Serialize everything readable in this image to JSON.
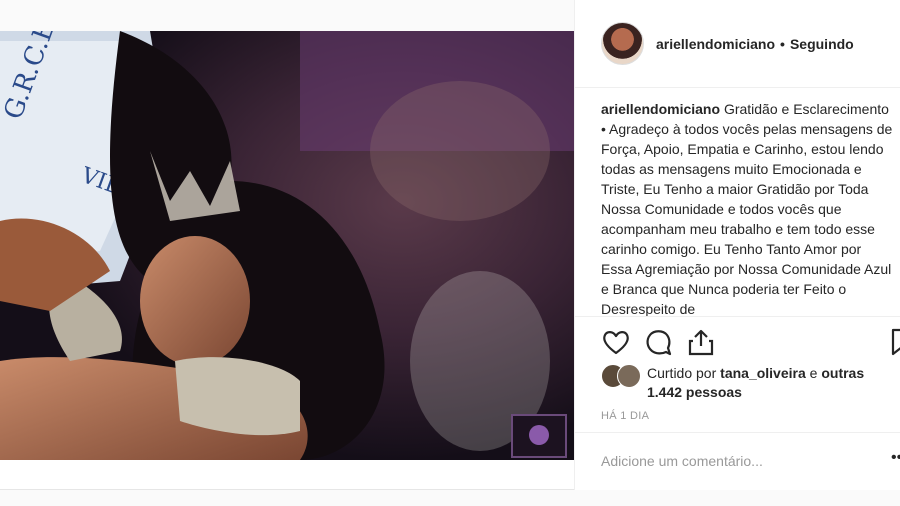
{
  "post": {
    "username": "ariellendomiciano",
    "separator": "•",
    "follow_status": "Seguindo",
    "caption_username": "ariellendomiciano",
    "caption_text": "Gratidão e Esclarecimento • Agradeço à todos vocês pelas mensagens de Força, Apoio, Empatia e Carinho, estou lendo todas as mensagens muito Emocionada e Triste, Eu Tenho a maior Gratidão por Toda Nossa Comunidade e todos vocês que acompanham meu trabalho e tem todo esse carinho comigo. Eu Tenho Tanto Amor por Essa Agremiação por Nossa Comunidade Azul e Branca que Nunca poderia ter Feito o Desrespeito de",
    "liked_by_prefix": "Curtido por",
    "liked_by_user": "tana_oliveira",
    "liked_by_conj": "e",
    "others_likes": "outras 1.442 pessoas",
    "time_ago": "HÁ 1 DIA",
    "comment_placeholder": "Adicione um comentário...",
    "more_glyph": "•••"
  },
  "icons": {
    "like": "heart-icon",
    "comment": "comment-icon",
    "share": "share-icon",
    "save": "bookmark-icon"
  },
  "colors": {
    "text": "#262626",
    "muted": "#999999",
    "border": "#efefef"
  }
}
